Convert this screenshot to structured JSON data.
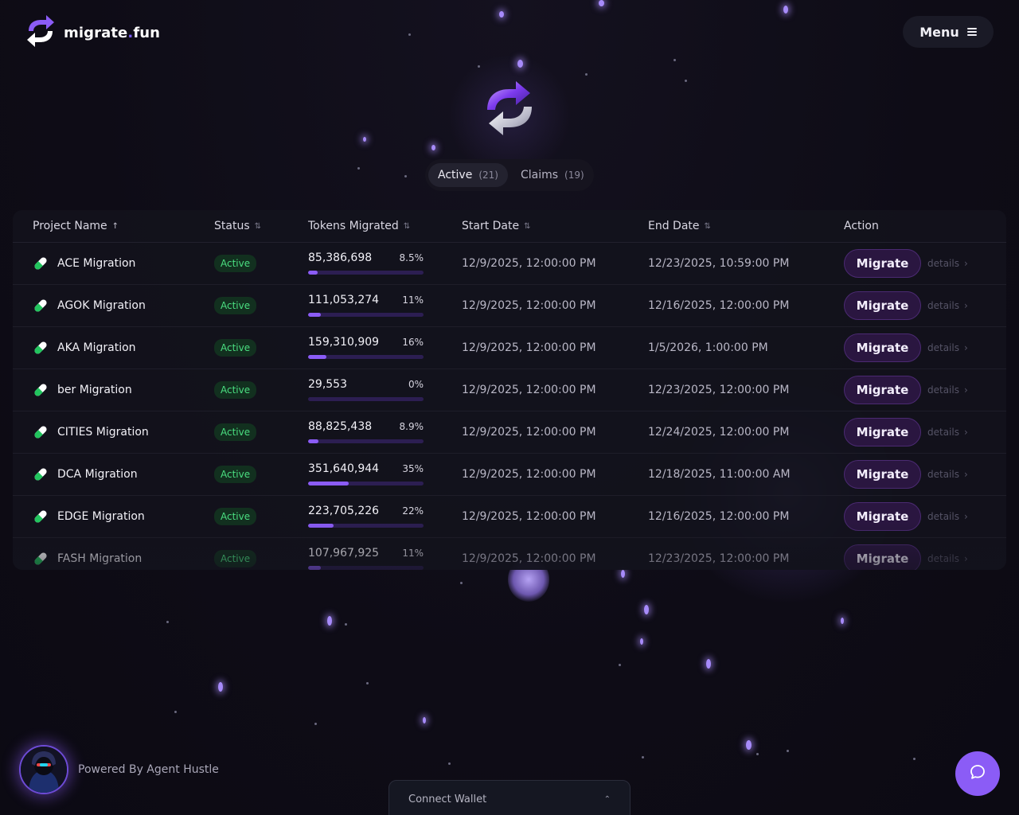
{
  "header": {
    "logo_text": "migrate",
    "logo_dot": ".",
    "logo_suffix": "fun",
    "menu_label": "Menu"
  },
  "tabs": [
    {
      "label": "Active",
      "count": "(21)"
    },
    {
      "label": "Claims",
      "count": "(19)"
    }
  ],
  "table": {
    "columns": {
      "project": "Project Name",
      "status": "Status",
      "tokens": "Tokens Migrated",
      "start": "Start Date",
      "end": "End Date",
      "action": "Action"
    },
    "rows": [
      {
        "name": "ACE Migration",
        "status": "Active",
        "tokens": "85,386,698",
        "pct": "8.5%",
        "fill": 0.085,
        "start": "12/9/2025, 12:00:00 PM",
        "end": "12/23/2025, 10:59:00 PM",
        "button": "Migrate",
        "details": "details"
      },
      {
        "name": "AGOK Migration",
        "status": "Active",
        "tokens": "111,053,274",
        "pct": "11%",
        "fill": 0.11,
        "start": "12/9/2025, 12:00:00 PM",
        "end": "12/16/2025, 12:00:00 PM",
        "button": "Migrate",
        "details": "details"
      },
      {
        "name": "AKA Migration",
        "status": "Active",
        "tokens": "159,310,909",
        "pct": "16%",
        "fill": 0.16,
        "start": "12/9/2025, 12:00:00 PM",
        "end": "1/5/2026, 1:00:00 PM",
        "button": "Migrate",
        "details": "details"
      },
      {
        "name": "ber Migration",
        "status": "Active",
        "tokens": "29,553",
        "pct": "0%",
        "fill": 0.0,
        "start": "12/9/2025, 12:00:00 PM",
        "end": "12/23/2025, 12:00:00 PM",
        "button": "Migrate",
        "details": "details"
      },
      {
        "name": "CITIES Migration",
        "status": "Active",
        "tokens": "88,825,438",
        "pct": "8.9%",
        "fill": 0.089,
        "start": "12/9/2025, 12:00:00 PM",
        "end": "12/24/2025, 12:00:00 PM",
        "button": "Migrate",
        "details": "details"
      },
      {
        "name": "DCA Migration",
        "status": "Active",
        "tokens": "351,640,944",
        "pct": "35%",
        "fill": 0.35,
        "start": "12/9/2025, 12:00:00 PM",
        "end": "12/18/2025, 11:00:00 AM",
        "button": "Migrate",
        "details": "details"
      },
      {
        "name": "EDGE Migration",
        "status": "Active",
        "tokens": "223,705,226",
        "pct": "22%",
        "fill": 0.22,
        "start": "12/9/2025, 12:00:00 PM",
        "end": "12/16/2025, 12:00:00 PM",
        "button": "Migrate",
        "details": "details"
      },
      {
        "name": "FASH Migration",
        "status": "Active",
        "tokens": "107,967,925",
        "pct": "11%",
        "fill": 0.11,
        "start": "12/9/2025, 12:00:00 PM",
        "end": "12/23/2025, 12:00:00 PM",
        "button": "Migrate",
        "details": "details"
      }
    ]
  },
  "footer": {
    "powered_by": "Powered By Agent Hustle",
    "connect_wallet": "Connect Wallet"
  },
  "colors": {
    "accent": "#8b5cf6",
    "status_active": "#4ade80",
    "background": "#0f0d18"
  },
  "icons": {
    "logo": "swap-arrows-icon",
    "menu": "hamburger-icon",
    "hero": "swap-arrows-icon",
    "row": "pill-icon",
    "details": "chevron-right-icon",
    "connect": "chevron-up-icon",
    "chat": "chat-bubble-icon"
  }
}
